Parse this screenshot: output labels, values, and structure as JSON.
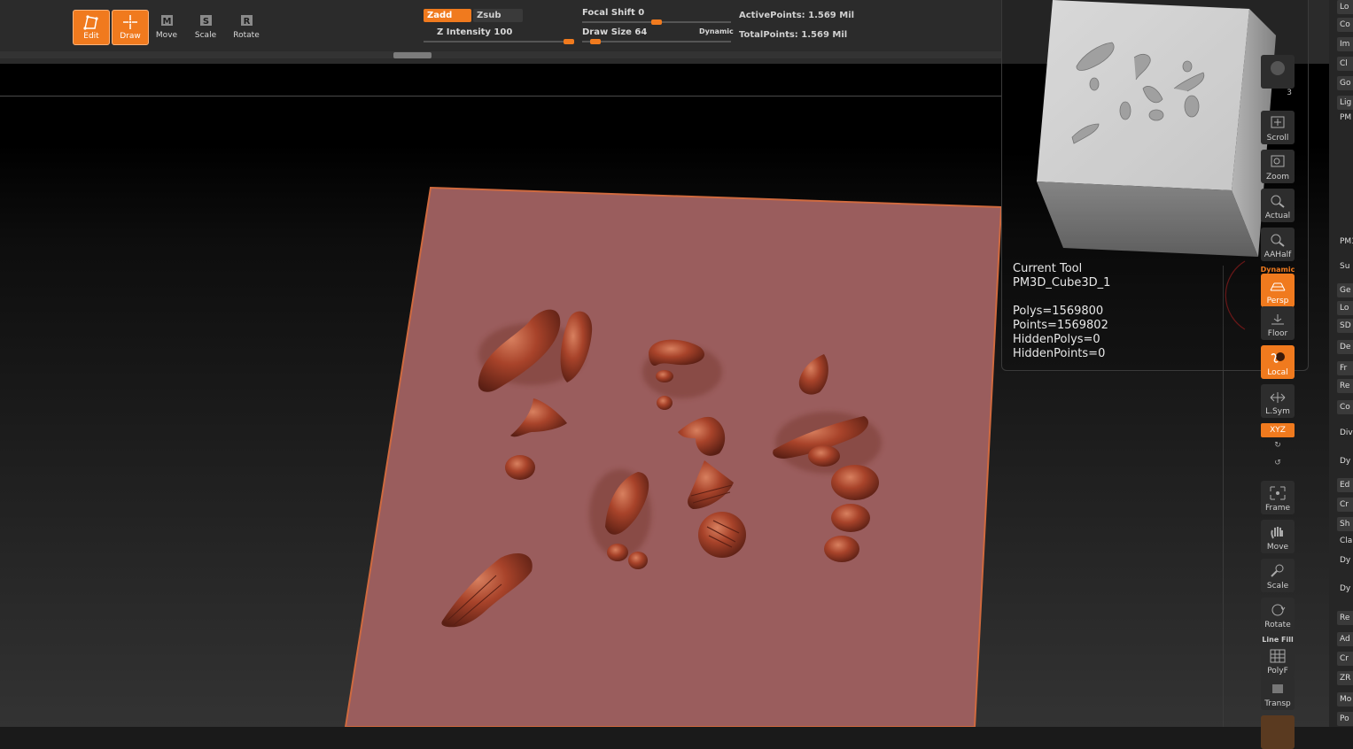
{
  "toolbar": {
    "edit": "Edit",
    "draw": "Draw",
    "move": "Move",
    "scale": "Scale",
    "rotate": "Rotate",
    "move_key": "M",
    "scale_key": "S",
    "rotate_key": "R",
    "zadd": "Zadd",
    "zsub": "Zsub",
    "z_intensity_label": "Z Intensity",
    "z_intensity_value": "100",
    "z_intensity_fraction": 1.0,
    "focal_shift_label": "Focal Shift",
    "focal_shift_value": "0",
    "focal_shift_fraction": 0.5,
    "draw_size_label": "Draw Size",
    "draw_size_value": "64",
    "draw_size_fraction": 0.06,
    "dynamic": "Dynamic",
    "active_points": "ActivePoints: 1.569 Mil",
    "total_points": "TotalPoints: 1.569 Mil"
  },
  "tool_info": {
    "title": "Current Tool",
    "name": "PM3D_Cube3D_1",
    "polys": "Polys=1569800",
    "points": "Points=1569802",
    "hidden_polys": "HiddenPolys=0",
    "hidden_points": "HiddenPoints=0"
  },
  "right_toolbar": {
    "spix": "3",
    "scroll": "Scroll",
    "zoom": "Zoom",
    "actual": "Actual",
    "aahalf": "AAHalf",
    "dynamic": "Dynamic",
    "persp": "Persp",
    "floor": "Floor",
    "local": "Local",
    "lsym": "L.Sym",
    "xyz": "XYZ",
    "frame": "Frame",
    "move": "Move",
    "scale": "Scale",
    "rotate": "Rotate",
    "line_fill": "Line Fill",
    "polyf": "PolyF",
    "transp": "Transp"
  },
  "right_panel": [
    "Lo",
    "Co",
    "Im",
    "Cl",
    "Go",
    "Lig",
    "PM",
    "PM3",
    "Su",
    "Ge",
    "Lo",
    "SD",
    "De",
    "Fr",
    "Re",
    "Co",
    "Div",
    "Dy",
    "Ed",
    "Cr",
    "Sh",
    "Cla",
    "Dy",
    "Dy",
    "Re",
    "Ad",
    "Cr",
    "ZR",
    "Mo",
    "Po"
  ],
  "colors": {
    "accent": "#f07a1e",
    "plane": "#9a5d5d",
    "clay": "#9c3a20"
  }
}
